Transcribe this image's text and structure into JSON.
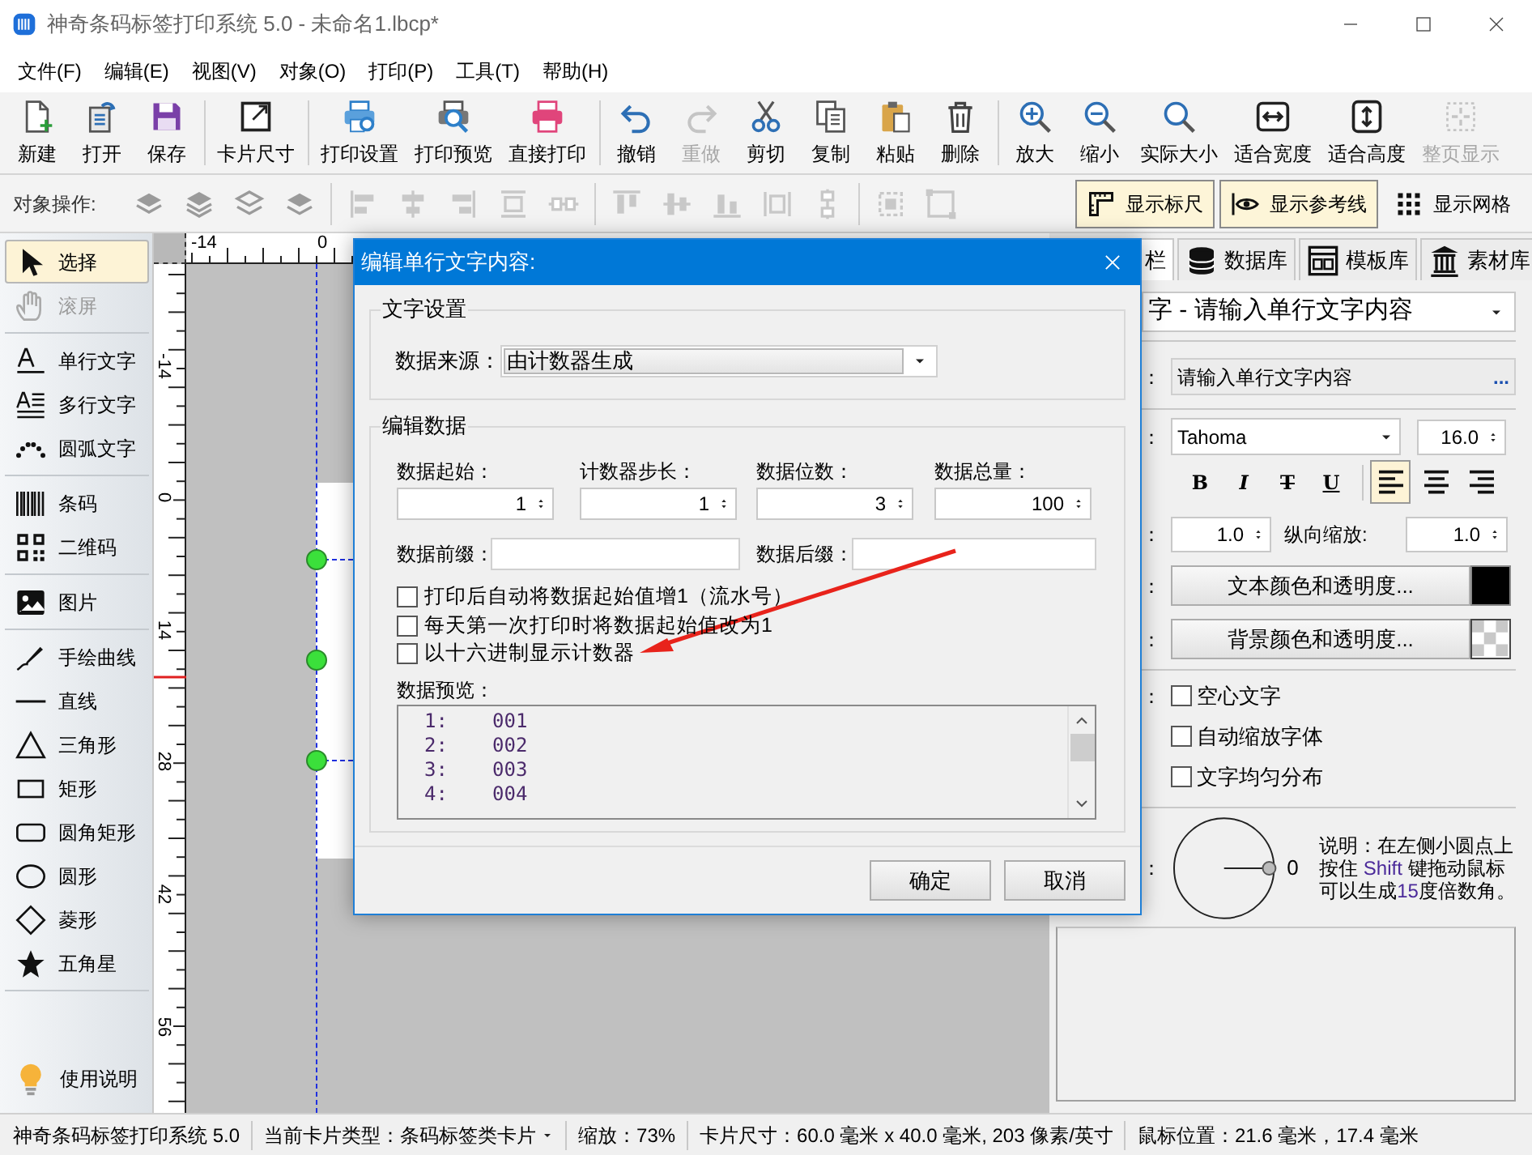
{
  "window": {
    "title": "神奇条码标签打印系统 5.0 - 未命名1.lbcp*"
  },
  "menu": [
    "文件(F)",
    "编辑(E)",
    "视图(V)",
    "对象(O)",
    "打印(P)",
    "工具(T)",
    "帮助(H)"
  ],
  "toolbar_groups": [
    [
      {
        "label": "新建",
        "disabled": false
      },
      {
        "label": "打开",
        "disabled": false
      },
      {
        "label": "保存",
        "disabled": false
      }
    ],
    [
      {
        "label": "卡片尺寸",
        "disabled": false
      }
    ],
    [
      {
        "label": "打印设置",
        "disabled": false
      },
      {
        "label": "打印预览",
        "disabled": false
      },
      {
        "label": "直接打印",
        "disabled": false
      }
    ],
    [
      {
        "label": "撤销",
        "disabled": false
      },
      {
        "label": "重做",
        "disabled": true
      },
      {
        "label": "剪切",
        "disabled": false
      },
      {
        "label": "复制",
        "disabled": false
      },
      {
        "label": "粘贴",
        "disabled": false
      },
      {
        "label": "删除",
        "disabled": false
      }
    ],
    [
      {
        "label": "放大",
        "disabled": false
      },
      {
        "label": "缩小",
        "disabled": false
      },
      {
        "label": "实际大小",
        "disabled": false
      },
      {
        "label": "适合宽度",
        "disabled": false
      },
      {
        "label": "适合高度",
        "disabled": false
      },
      {
        "label": "整页显示",
        "disabled": true
      }
    ]
  ],
  "object_bar": {
    "label": "对象操作:",
    "toggles": [
      {
        "label": "显示标尺",
        "selected": true
      },
      {
        "label": "显示参考线",
        "selected": true
      },
      {
        "label": "显示网格",
        "selected": false
      }
    ]
  },
  "tool_groups": [
    [
      {
        "label": "选择",
        "selected": true,
        "disabled": false
      },
      {
        "label": "滚屏",
        "selected": false,
        "disabled": true
      }
    ],
    [
      {
        "label": "单行文字",
        "selected": false,
        "disabled": false
      },
      {
        "label": "多行文字",
        "selected": false,
        "disabled": false
      },
      {
        "label": "圆弧文字",
        "selected": false,
        "disabled": false
      }
    ],
    [
      {
        "label": "条码",
        "selected": false,
        "disabled": false
      },
      {
        "label": "二维码",
        "selected": false,
        "disabled": false
      }
    ],
    [
      {
        "label": "图片",
        "selected": false,
        "disabled": false
      }
    ],
    [
      {
        "label": "手绘曲线",
        "selected": false,
        "disabled": false
      },
      {
        "label": "直线",
        "selected": false,
        "disabled": false
      },
      {
        "label": "三角形",
        "selected": false,
        "disabled": false
      },
      {
        "label": "矩形",
        "selected": false,
        "disabled": false
      },
      {
        "label": "圆角矩形",
        "selected": false,
        "disabled": false
      },
      {
        "label": "圆形",
        "selected": false,
        "disabled": false
      },
      {
        "label": "菱形",
        "selected": false,
        "disabled": false
      },
      {
        "label": "五角星",
        "selected": false,
        "disabled": false
      }
    ]
  ],
  "help_button": {
    "label": "使用说明"
  },
  "canvas": {
    "top_ruler": [
      "-14",
      "0"
    ],
    "left_ruler": [
      "-14",
      "0",
      "14",
      "28",
      "42",
      "56"
    ]
  },
  "properties_panel": {
    "tabs": [
      {
        "label": "栏",
        "selected": true
      },
      {
        "label": "数据库",
        "selected": false
      },
      {
        "label": "模板库",
        "selected": false
      },
      {
        "label": "素材库",
        "selected": false
      }
    ],
    "object_select": "字 - 请输入单行文字内容",
    "content_row": {
      "label_tail": "：",
      "value": "请输入单行文字内容",
      "more": "..."
    },
    "font_row": {
      "label_tail": "：",
      "font": "Tahoma",
      "size": "16.0"
    },
    "style_buttons": [
      {
        "label": "B",
        "selected": false
      },
      {
        "label": "I",
        "selected": false
      },
      {
        "label": "T",
        "selected": false
      },
      {
        "label": "U",
        "selected": false
      }
    ],
    "align_buttons": [
      {
        "selected": true
      },
      {
        "selected": false
      },
      {
        "selected": false
      }
    ],
    "scale_row": {
      "label_tail": "：",
      "horizontal": "1.0",
      "vertical_label": "纵向缩放:",
      "vertical": "1.0"
    },
    "color_rows": [
      {
        "label_tail": "：",
        "button": "文本颜色和透明度...",
        "kind": "solid",
        "color": "#000000"
      },
      {
        "label_tail": "：",
        "button": "背景颜色和透明度...",
        "kind": "checker"
      }
    ],
    "options_label_tail": "：",
    "options": [
      {
        "label": "空心文字",
        "checked": false
      },
      {
        "label": "自动缩放字体",
        "checked": false
      },
      {
        "label": "文字均匀分布",
        "checked": false
      }
    ],
    "rotation": {
      "label_tail": "：",
      "value": "0",
      "note": [
        {
          "text": "说明：在左侧小圆点上按住 ",
          "highlight": false
        },
        {
          "text": "Shift",
          "highlight": true
        },
        {
          "text": " 键拖动鼠标可以生成",
          "highlight": false
        },
        {
          "text": "15",
          "highlight": true
        },
        {
          "text": "度倍数角。",
          "highlight": false
        }
      ]
    }
  },
  "dialog": {
    "title": "编辑单行文字内容:",
    "text_settings": {
      "legend": "文字设置",
      "source_label": "数据来源：",
      "source_value": "由计数器生成"
    },
    "edit_data": {
      "legend": "编辑数据",
      "spinners": [
        {
          "label": "数据起始：",
          "value": "1"
        },
        {
          "label": "计数器步长：",
          "value": "1"
        },
        {
          "label": "数据位数：",
          "value": "3"
        },
        {
          "label": "数据总量：",
          "value": "100"
        }
      ],
      "prefix_label": "数据前缀：",
      "suffix_label": "数据后缀：",
      "options": [
        {
          "label": "打印后自动将数据起始值增1（流水号）",
          "checked": false
        },
        {
          "label": "每天第一次打印时将数据起始值改为1",
          "checked": false
        },
        {
          "label": "以十六进制显示计数器",
          "checked": false
        }
      ],
      "preview_label": "数据预览：",
      "preview_rows": [
        {
          "index": "1:",
          "value": "001"
        },
        {
          "index": "2:",
          "value": "002"
        },
        {
          "index": "3:",
          "value": "003"
        },
        {
          "index": "4:",
          "value": "004"
        }
      ]
    },
    "buttons": [
      "确定",
      "取消"
    ]
  },
  "status_bar": {
    "app": "神奇条码标签打印系统 5.0",
    "card_type": "当前卡片类型：条码标签类卡片",
    "zoom": "缩放：73%",
    "card_size": "卡片尺寸：60.0 毫米 x 40.0 毫米, 203 像素/英寸",
    "mouse": "鼠标位置：21.6 毫米，17.4 毫米"
  }
}
